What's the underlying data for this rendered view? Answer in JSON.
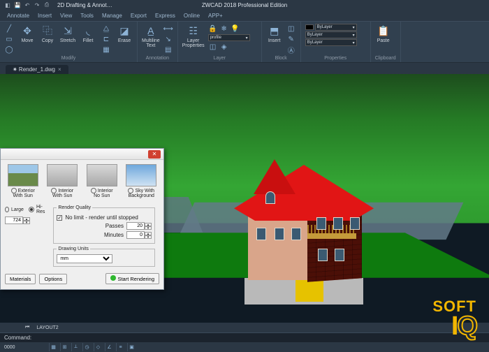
{
  "app": {
    "title": "ZWCAD 2018 Professional Edition",
    "workspace": "2D Drafting & Annot…"
  },
  "menus": [
    "Annotate",
    "Insert",
    "View",
    "Tools",
    "Manage",
    "Export",
    "Express",
    "Online",
    "APP+"
  ],
  "ribbon": {
    "modify": {
      "label": "Modify",
      "items": [
        {
          "icon": "move-icon",
          "label": "Move"
        },
        {
          "icon": "copy-icon",
          "label": "Copy"
        },
        {
          "icon": "stretch-icon",
          "label": "Stretch"
        },
        {
          "icon": "fillet-icon",
          "label": "Fillet"
        },
        {
          "icon": "erase-icon",
          "label": "Erase"
        }
      ]
    },
    "annotation": {
      "label": "Annotation",
      "items": [
        {
          "icon": "mtext-icon",
          "label": "Multiline\nText"
        }
      ]
    },
    "layer": {
      "label": "Layer",
      "btn": {
        "icon": "layers-icon",
        "label": "Layer\nProperties"
      },
      "combo": "profile"
    },
    "block": {
      "label": "Block",
      "btn": {
        "icon": "insert-icon",
        "label": "Insert"
      }
    },
    "properties": {
      "label": "Properties",
      "combos": [
        "ByLayer",
        "ByLayer",
        "ByLayer"
      ]
    },
    "clipboard": {
      "label": "Clipboard",
      "btn": {
        "icon": "paste-icon",
        "label": "Paste"
      }
    }
  },
  "doc_tab": "✷ Render_1.dwg",
  "dialog": {
    "thumbs": [
      {
        "id": "exterior-sun",
        "label": "Exterior\nWith Sun"
      },
      {
        "id": "interior-sun",
        "label": "Interior\nWith Sun"
      },
      {
        "id": "interior-nosun",
        "label": "Interior\nNo Sun"
      },
      {
        "id": "sky-bg",
        "label": "Sky With\nBackground"
      }
    ],
    "size": {
      "legend": "",
      "large": "Large",
      "hires": "Hi-Res",
      "value": "724"
    },
    "quality": {
      "legend": "Render Quality",
      "nolimit": "No limit - render until stopped",
      "passes_label": "Passes",
      "passes": "20",
      "minutes_label": "Minutes",
      "minutes": "0"
    },
    "units": {
      "legend": "Drawing Units",
      "value": "mm"
    },
    "buttons": {
      "materials": "Materials",
      "options": "Options",
      "start": "Start Rendering"
    }
  },
  "layout_tab": "LAYOUT2",
  "command_prompt": "Command:",
  "status": {
    "coords": "0000"
  },
  "watermark": {
    "line1": "SOFT",
    "line2a": "I",
    "line2b": "Q"
  }
}
